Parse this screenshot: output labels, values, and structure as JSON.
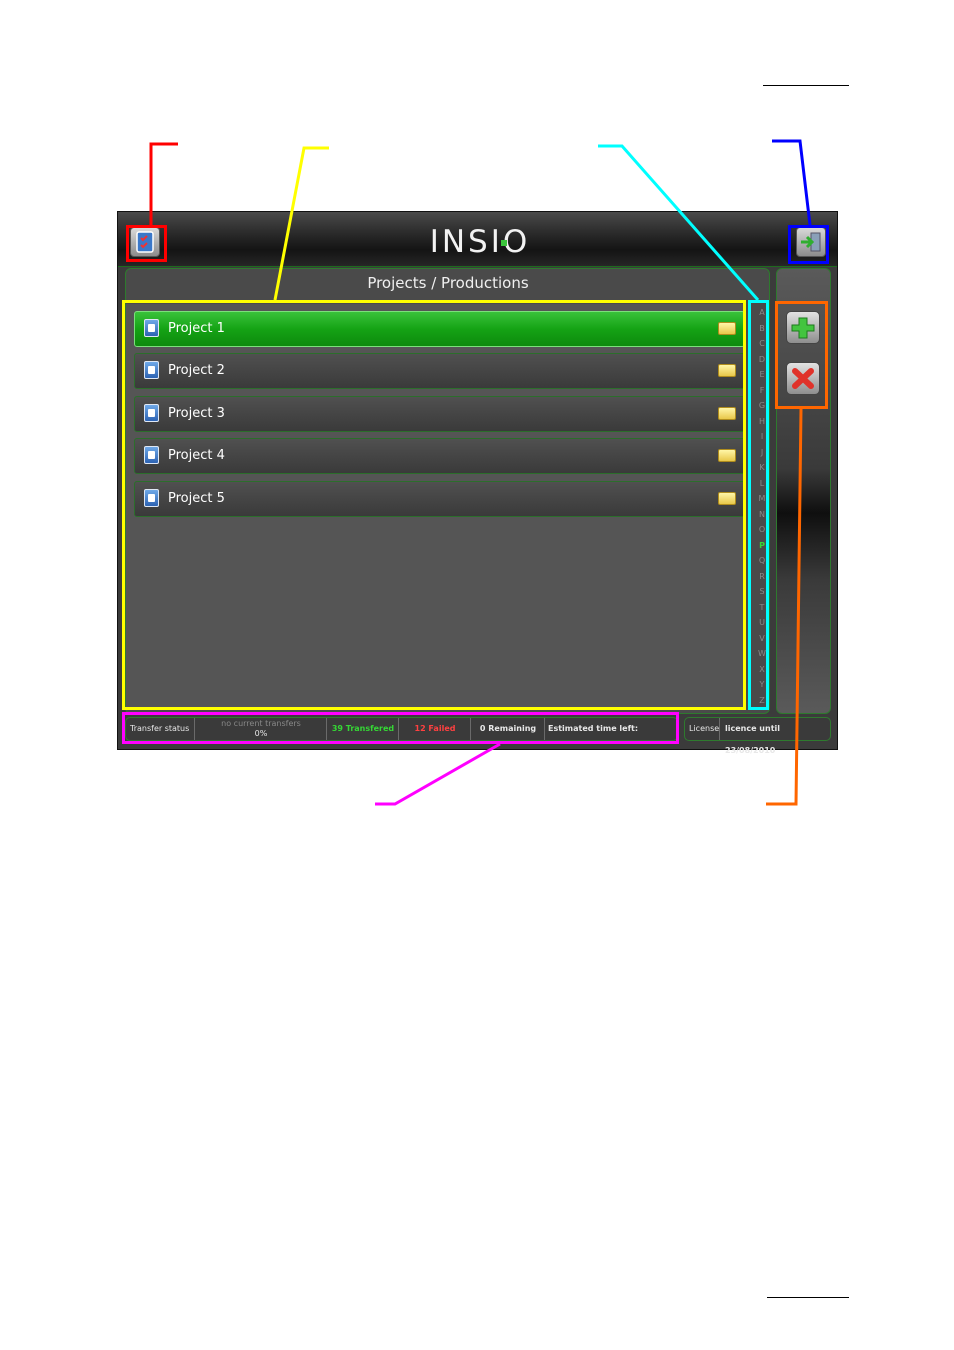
{
  "app": {
    "logo_text": "INSIO",
    "panel_title": "Projects / Productions",
    "projects": [
      {
        "label": "Project 1",
        "selected": true
      },
      {
        "label": "Project 2",
        "selected": false
      },
      {
        "label": "Project 3",
        "selected": false
      },
      {
        "label": "Project 4",
        "selected": false
      },
      {
        "label": "Project 5",
        "selected": false
      }
    ],
    "alphabet": [
      "A",
      "B",
      "C",
      "D",
      "E",
      "F",
      "G",
      "H",
      "I",
      "J",
      "K",
      "L",
      "M",
      "N",
      "O",
      "P",
      "Q",
      "R",
      "S",
      "T",
      "U",
      "V",
      "W",
      "X",
      "Y",
      "Z"
    ],
    "active_letter": "P",
    "status": {
      "label": "Transfer status",
      "current": "no current transfers",
      "progress": "0%",
      "transferred": "39 Transfered",
      "failed": "12 Failed",
      "remaining": "0 Remaining",
      "time_left": "Estimated time left:"
    },
    "license": {
      "label": "License",
      "value": "licence until 23/08/2010"
    }
  },
  "icons": {
    "top_left": "projects-icon",
    "top_right": "exit-icon",
    "add": "add-icon",
    "delete": "delete-icon",
    "folder": "folder-icon"
  },
  "colors": {
    "accent_green": "#15a315",
    "transferred": "#35d635",
    "failed": "#ff4040",
    "annot_red": "#ff0000",
    "annot_yellow": "#ffff00",
    "annot_cyan": "#00ffff",
    "annot_blue": "#0000ff",
    "annot_orange": "#ff6600",
    "annot_magenta": "#ff00ff"
  }
}
